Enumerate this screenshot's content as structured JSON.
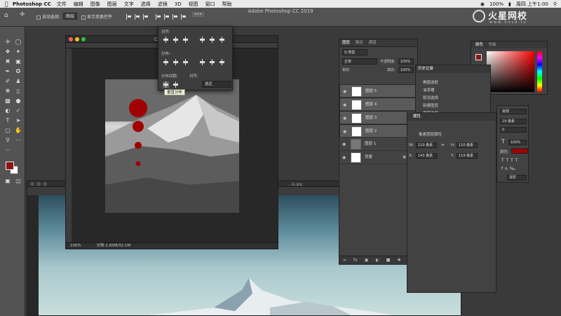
{
  "menubar": {
    "app_name": "Photoshop CC",
    "items": [
      "文件",
      "编辑",
      "图像",
      "图层",
      "文字",
      "选择",
      "滤镜",
      "3D",
      "视图",
      "窗口",
      "帮助"
    ],
    "battery": "100%",
    "clock": "周四 上午1:00"
  },
  "window_title": "Adobe Photoshop CC 2019",
  "options_bar": {
    "auto_select_label": "自动选择:",
    "auto_select_value": "图层",
    "show_transform_label": "显示变换控件"
  },
  "doc1": {
    "title": "CD封面",
    "zoom": "100%",
    "doc_size": "文档:1.83M/32.1M"
  },
  "align_panel": {
    "align_label": "对齐:",
    "distribute_label": "分布:",
    "distribute_spacing_label": "分布间距:",
    "align_to_label": "对齐:",
    "align_to_value": "选区",
    "tooltip": "垂直分布"
  },
  "doc2": {
    "title": "...山.jpg"
  },
  "layers_panel": {
    "tabs": [
      "图层",
      "路径",
      "通道"
    ],
    "kind_filter": "Q 类型",
    "blend_mode": "正常",
    "opacity_label": "不透明度:",
    "opacity_value": "100%",
    "lock_label": "锁定:",
    "fill_label": "填充:",
    "fill_value": "100%",
    "layers": [
      {
        "name": "图层 5",
        "selected": true
      },
      {
        "name": "图层 4",
        "selected": true
      },
      {
        "name": "图层 3",
        "selected": true
      },
      {
        "name": "图层 2",
        "selected": true
      },
      {
        "name": "图层 1",
        "selected": false
      },
      {
        "name": "背景",
        "selected": false
      }
    ]
  },
  "history_panel": {
    "title": "历史记录",
    "items": [
      "椭圆选框",
      "油漆桶",
      "取消选择",
      "新建图层",
      "椭圆选框"
    ]
  },
  "properties_panel": {
    "title": "属性",
    "subtitle": "像素图层属性",
    "w_value": "110 像素",
    "h_value": "110 像素",
    "x_value": "143 像素",
    "y_value": "119 像素",
    "w_label": "W:",
    "h_label": "H:",
    "x_label": "X:",
    "y_label": "Y:"
  },
  "char_panel": {
    "style": "常规",
    "size": "19 像素",
    "tracking": "0",
    "scale": "100%",
    "color_label": "颜色:",
    "aa": "浑厚"
  },
  "color_panel": {
    "tabs": [
      "颜色",
      "色板"
    ]
  },
  "watermark": {
    "brand": "火星网校",
    "url": "www.hxsd.tv"
  },
  "colors": {
    "foreground": "#8b1414",
    "circle_red": "#a00000"
  }
}
